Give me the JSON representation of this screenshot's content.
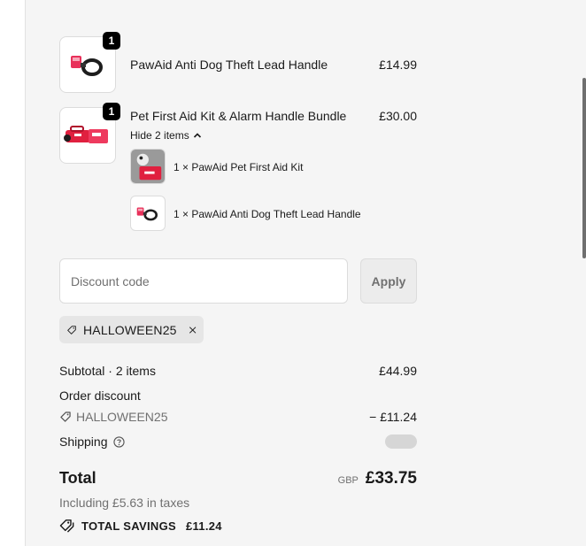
{
  "cart": {
    "items": [
      {
        "title": "PawAid Anti Dog Theft Lead Handle",
        "price": "£14.99",
        "quantity": "1",
        "icon": "dog-lead-handle-product-image"
      },
      {
        "title": "Pet First Aid Kit & Alarm Handle Bundle",
        "price": "£30.00",
        "quantity": "1",
        "icon": "first-aid-kit-bundle-product-image",
        "toggle_label": "Hide 2 items",
        "bundle_items": [
          {
            "label": "1 × PawAid Pet First Aid Kit",
            "icon": "first-aid-kit-product-image"
          },
          {
            "label": "1 × PawAid Anti Dog Theft Lead Handle",
            "icon": "dog-lead-handle-product-image"
          }
        ]
      }
    ]
  },
  "discount": {
    "placeholder": "Discount code",
    "apply_label": "Apply",
    "applied_code": "HALLOWEEN25"
  },
  "summary": {
    "subtotal_label": "Subtotal · 2 items",
    "subtotal_value": "£44.99",
    "order_discount_label": "Order discount",
    "discount_code": "HALLOWEEN25",
    "discount_value": "− £11.24",
    "shipping_label": "Shipping",
    "total_label": "Total",
    "currency": "GBP",
    "total_value": "£33.75",
    "taxes_note": "Including £5.63 in taxes",
    "savings_label": "TOTAL SAVINGS",
    "savings_value": "£11.24"
  },
  "colors": {
    "panel_bg": "#f5f5f5",
    "badge_bg": "#000000",
    "brand_pink": "#e8305a",
    "muted_text": "#707070"
  }
}
